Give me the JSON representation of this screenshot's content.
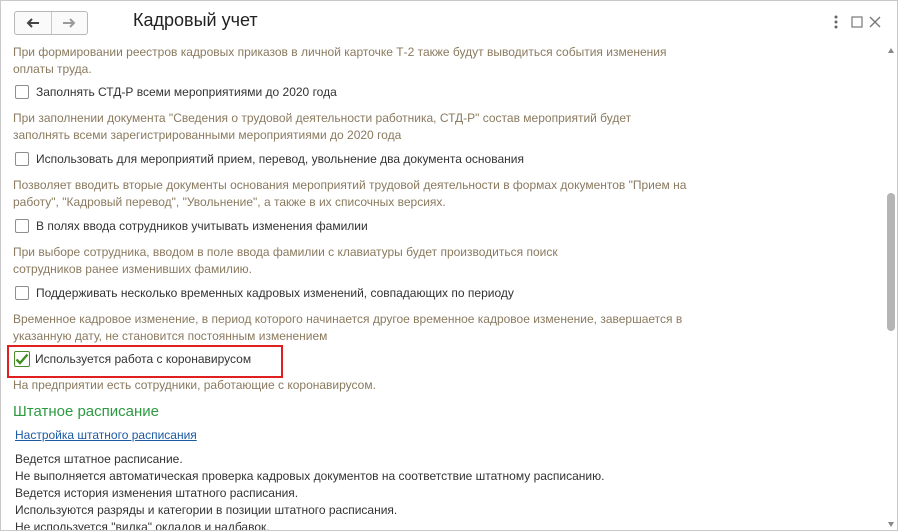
{
  "window": {
    "title": "Кадровый учет"
  },
  "notes": {
    "payroll_registry": [
      "При формировании реестров кадровых приказов в личной карточке Т-2 также будут выводиться события изменения",
      "оплаты труда."
    ],
    "stdr": [
      "При заполнении документа \"Сведения о трудовой деятельности работника, СТД-Р\" состав мероприятий будет",
      "заполнять всеми зарегистрированными мероприятиями до 2020 года"
    ],
    "two_docs": [
      "Позволяет вводить вторые документы основания мероприятий трудовой деятельности в формах документов \"Прием на",
      "работу\", \"Кадровый перевод\", \"Увольнение\", а также в их списочных версиях."
    ],
    "surname": [
      "При выборе сотрудника, вводом в поле ввода фамилии с клавиатуры будет производиться поиск",
      "сотрудников ранее изменивших фамилию."
    ],
    "temp_changes": [
      "Временное кадровое изменение, в период которого начинается другое временное кадровое изменение, завершается в",
      "указанную дату, не становится постоянным изменением"
    ],
    "coronavirus": [
      "На предприятии есть сотрудники, работающие с коронавирусом."
    ]
  },
  "checkboxes": [
    {
      "label": "Заполнять СТД-Р всеми мероприятиями до 2020 года",
      "checked": false
    },
    {
      "label": "Использовать для мероприятий прием, перевод, увольнение два документа основания",
      "checked": false
    },
    {
      "label": "В полях ввода сотрудников учитывать изменения фамилии",
      "checked": false
    },
    {
      "label": "Поддерживать несколько временных кадровых изменений, совпадающих по периоду",
      "checked": false
    },
    {
      "label": "Используется работа с коронавирусом",
      "checked": true
    }
  ],
  "staffing": {
    "section_title": "Штатное расписание",
    "link": "Настройка штатного расписания",
    "lines": [
      "Ведется штатное расписание.",
      "Не выполняется автоматическая проверка кадровых документов на соответствие штатному расписанию.",
      "Ведется история изменения штатного расписания.",
      "Используются разряды и категории в позиции штатного расписания.",
      "Не используется \"вилка\" окладов и надбавок."
    ]
  },
  "colors": {
    "note": "#8a7a5f",
    "section": "#2c9a41",
    "link": "#1c5aa3",
    "highlight": "#e02020",
    "check": "#3f8f1f"
  }
}
